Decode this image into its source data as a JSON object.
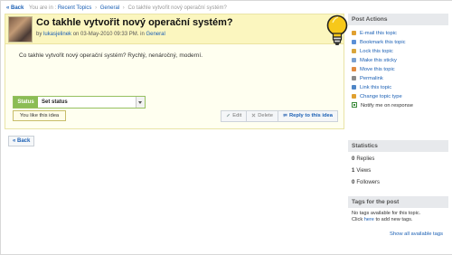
{
  "breadcrumb": {
    "back": "« Back",
    "you_are_in": "You are in :",
    "item1": "Recent Topics",
    "item2": "General",
    "current": "Co takhle vytvořit nový operační systém?",
    "sep": "›"
  },
  "topic": {
    "title": "Co takhle vytvořit nový operační systém?",
    "by": "by",
    "author": "lukasjelinek",
    "on_date": "on 03-May-2010 09:33 PM.",
    "in": "in",
    "category": "General",
    "body": "Co takhle vytvořit nový operační systém? Rychlý, nenáročný, moderní.",
    "status_label": "Status",
    "status_value": "Set status",
    "like_text": "You like this idea",
    "edit": "Edit",
    "delete": "Delete",
    "reply": "Reply to this idea"
  },
  "back_button": "Back",
  "post_actions": {
    "title": "Post Actions",
    "items": [
      {
        "label": "E-mail this topic",
        "icon": "email-icon",
        "color": "#e0a030"
      },
      {
        "label": "Bookmark this topic",
        "icon": "bookmark-icon",
        "color": "#5b8fd6"
      },
      {
        "label": "Lock this topic",
        "icon": "lock-icon",
        "color": "#d9a53a"
      },
      {
        "label": "Make this sticky",
        "icon": "pin-icon",
        "color": "#7aa0d0"
      },
      {
        "label": "Move this topic",
        "icon": "move-icon",
        "color": "#e08a40"
      },
      {
        "label": "Permalink",
        "icon": "permalink-icon",
        "color": "#8a8a8a"
      },
      {
        "label": "Link this topic",
        "icon": "link-icon",
        "color": "#4f86c6"
      },
      {
        "label": "Change topic type",
        "icon": "change-type-icon",
        "color": "#e0a030"
      },
      {
        "label": "Notify me on response",
        "icon": "checkbox-icon",
        "color": "#3a8a3a"
      }
    ]
  },
  "statistics": {
    "title": "Statistics",
    "replies_count": "0",
    "replies_label": "Replies",
    "views_count": "1",
    "views_label": "Views",
    "followers_count": "0",
    "followers_label": "Followers"
  },
  "tags": {
    "title": "Tags for the post",
    "line1": "No tags available for this topic.",
    "click": "Click",
    "here": "here",
    "line2_rest": "to add new tags.",
    "show_all": "Show all available tags"
  }
}
